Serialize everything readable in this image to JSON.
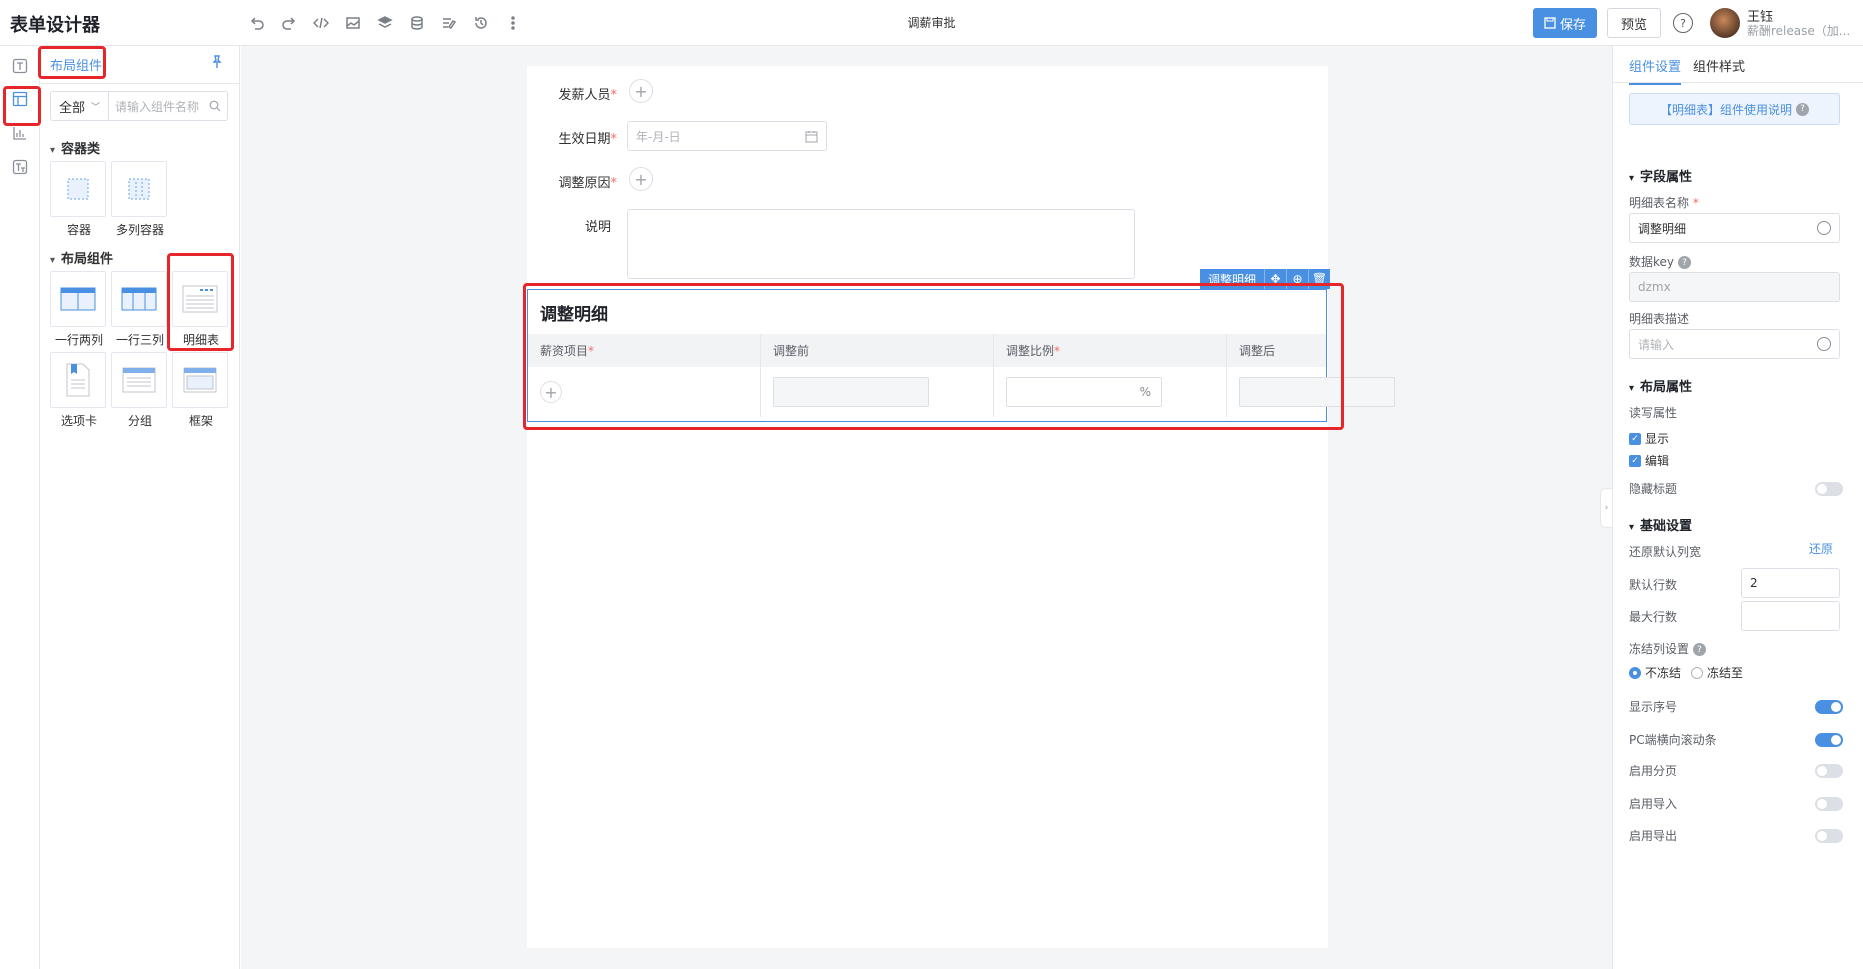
{
  "header": {
    "app_title": "表单设计器",
    "form_name": "调薪审批",
    "save_label": "保存",
    "preview_label": "预览",
    "help_glyph": "?",
    "user_name": "王钰",
    "user_sub": "薪酬release（加..."
  },
  "toolbar": {
    "icons": [
      "undo-icon",
      "redo-icon",
      "code-icon",
      "image-icon",
      "layers-icon",
      "database-icon",
      "edit-list-icon",
      "history-icon",
      "more-icon"
    ]
  },
  "rail": {
    "items": [
      "text-field-icon",
      "layout-icon",
      "chart-icon",
      "text-box-icon"
    ]
  },
  "library": {
    "tab": "布局组件",
    "filter": "全部",
    "search_placeholder": "请输入组件名称",
    "container_section": "容器类",
    "containers": [
      "容器",
      "多列容器"
    ],
    "layout_section": "布局组件",
    "layouts": [
      "一行两列",
      "一行三列",
      "明细表",
      "选项卡",
      "分组",
      "框架"
    ]
  },
  "form": {
    "fields": [
      {
        "label": "发薪人员",
        "required": "*"
      },
      {
        "label": "生效日期",
        "required": "*",
        "placeholder": "年-月-日"
      },
      {
        "label": "调整原因",
        "required": "*"
      },
      {
        "label": "说明",
        "required": ""
      }
    ]
  },
  "detail_table": {
    "toolbar_label": "调整明细",
    "title": "调整明细",
    "columns": [
      {
        "label": "薪资项目",
        "required": "*"
      },
      {
        "label": "调整前",
        "required": ""
      },
      {
        "label": "调整比例",
        "required": "*"
      },
      {
        "label": "调整后",
        "required": ""
      }
    ],
    "percent_suffix": "%",
    "add_glyph": "+"
  },
  "props": {
    "tab_settings": "组件设置",
    "tab_style": "组件样式",
    "help_link": "【明细表】组件使用说明",
    "field_section": "字段属性",
    "name_label": "明细表名称",
    "name_value": "调整明细",
    "key_label": "数据key",
    "key_value": "dzmx",
    "desc_label": "明细表描述",
    "desc_placeholder": "请输入",
    "layout_section": "布局属性",
    "rw_label": "读写属性",
    "show_label": "显示",
    "edit_label": "编辑",
    "hide_title_label": "隐藏标题",
    "basic_section": "基础设置",
    "reset_width_label": "还原默认列宽",
    "reset_link": "还原",
    "default_rows_label": "默认行数",
    "default_rows_value": "2",
    "max_rows_label": "最大行数",
    "max_rows_value": "",
    "freeze_label": "冻结列设置",
    "freeze_none": "不冻结",
    "freeze_to": "冻结至",
    "show_index_label": "显示序号",
    "show_index": true,
    "pc_scroll_label": "PC端横向滚动条",
    "pc_scroll": true,
    "paging_label": "启用分页",
    "paging": false,
    "import_label": "启用导入",
    "import": false,
    "export_label": "启用导出",
    "export": false
  },
  "colors": {
    "accent": "#4a90e2",
    "highlight": "#e5262a",
    "required": "#f56c6c"
  }
}
